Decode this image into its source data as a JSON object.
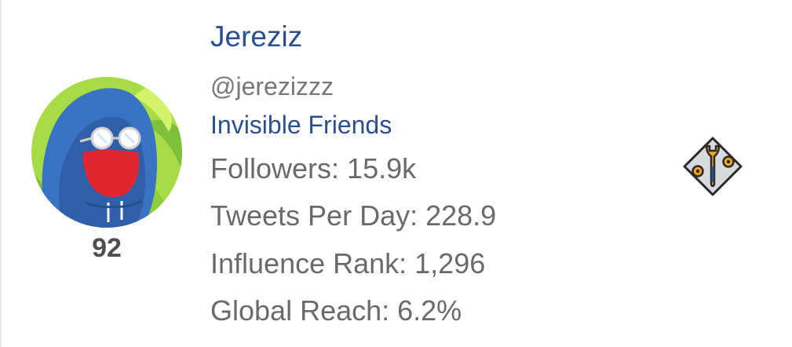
{
  "profile": {
    "name": "Jereziz",
    "handle": "@jerezizzz",
    "community": "Invisible Friends",
    "score": "92",
    "avatar_icon": "hooded-figure-avatar"
  },
  "stats": [
    {
      "label": "Followers",
      "value": "15.9k",
      "text": "Followers: 15.9k"
    },
    {
      "label": "Tweets Per Day",
      "value": "228.9",
      "text": "Tweets Per Day: 228.9"
    },
    {
      "label": "Influence Rank",
      "value": "1,296",
      "text": "Influence Rank: 1,296"
    },
    {
      "label": "Global Reach",
      "value": "6.2%",
      "text": "Global Reach: 6.2%"
    }
  ],
  "actions": {
    "tool_icon": "wrench-gear-icon"
  },
  "colors": {
    "link": "#2b4f8f",
    "muted": "#777777",
    "stat_text": "#6a6a6a",
    "score_text": "#4f4f4f",
    "avatar_blue": "#3a72c4",
    "avatar_green": "#9bd63a",
    "avatar_red": "#e0262f",
    "tool_orange": "#f2a21b"
  }
}
